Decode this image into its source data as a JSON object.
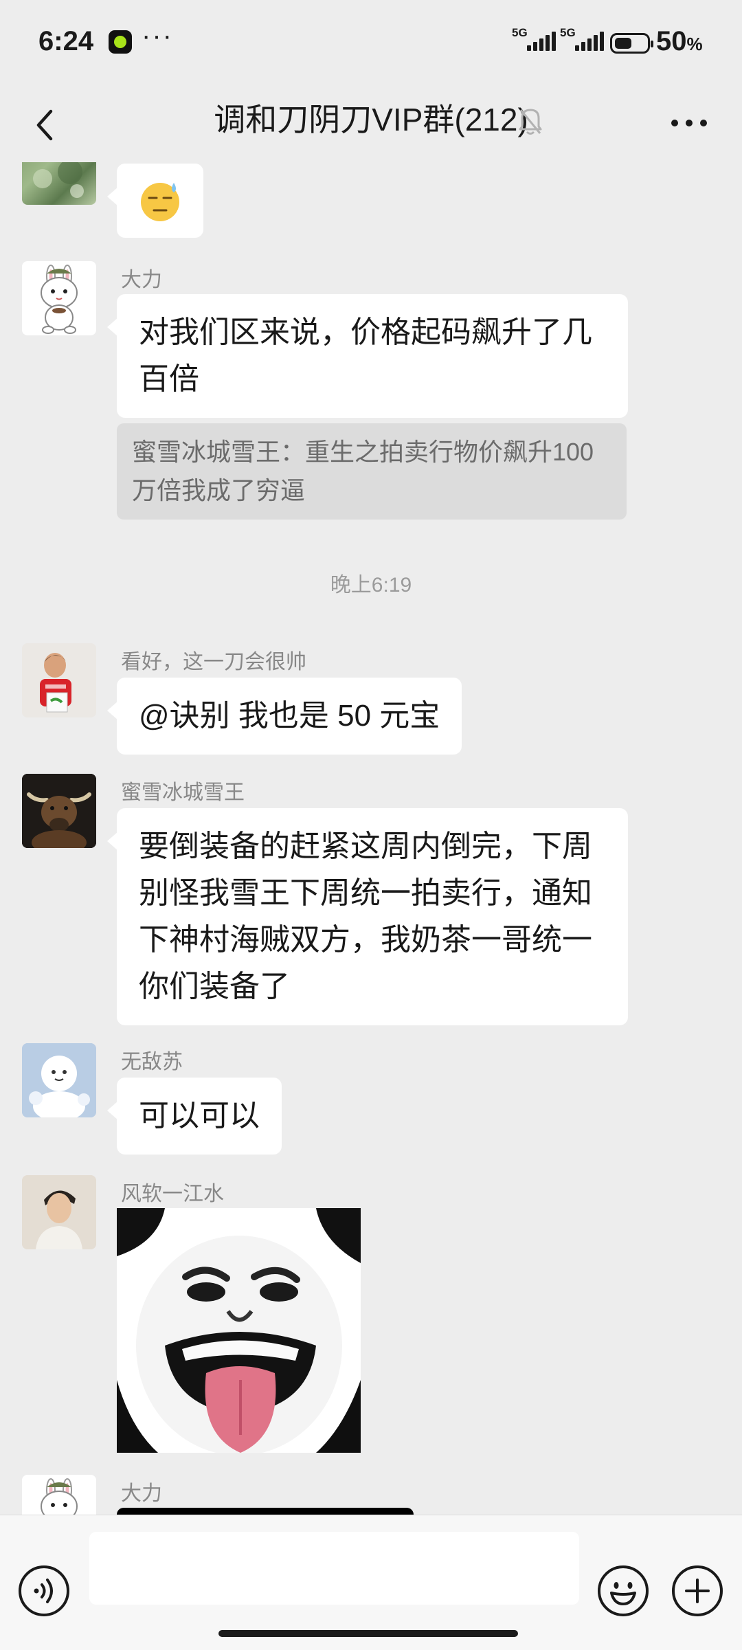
{
  "status_bar": {
    "time": "6:24",
    "more": "···",
    "network1": "5G",
    "network2": "5G",
    "battery_value": "50",
    "battery_unit": "%"
  },
  "header": {
    "title": "调和刀阴刀VIP群(212)",
    "muted": true
  },
  "messages": [
    {
      "sender": "",
      "type": "emoji",
      "content": "😓"
    },
    {
      "sender": "大力",
      "type": "text",
      "content": "对我们区来说，价格起码飙升了几百倍",
      "quote": "蜜雪冰城雪王：重生之拍卖行物价飙升100万倍我成了穷逼"
    },
    {
      "type": "time",
      "content": "晚上6:19"
    },
    {
      "sender": "看好，这一刀会很帅",
      "type": "text",
      "content": "@诀别  我也是 50 元宝"
    },
    {
      "sender": "蜜雪冰城雪王",
      "type": "text",
      "content": "要倒装备的赶紧这周内倒完，下周别怪我雪王下周统一拍卖行，通知下神村海贼双方，我奶茶一哥统一你们装备了"
    },
    {
      "sender": "无敌苏",
      "type": "text",
      "content": "可以可以"
    },
    {
      "sender": "风软一江水",
      "type": "sticker",
      "content": "panda-meme-sticker"
    },
    {
      "sender": "大力",
      "type": "text",
      "content": ""
    }
  ],
  "colors": {
    "background": "#ededed",
    "bubble": "#ffffff",
    "quote": "#dcdcdc",
    "sender_name": "#888888"
  },
  "input_bar": {
    "voice_icon": "voice-icon",
    "emoji_icon": "emoji-icon",
    "plus_icon": "plus-icon"
  }
}
